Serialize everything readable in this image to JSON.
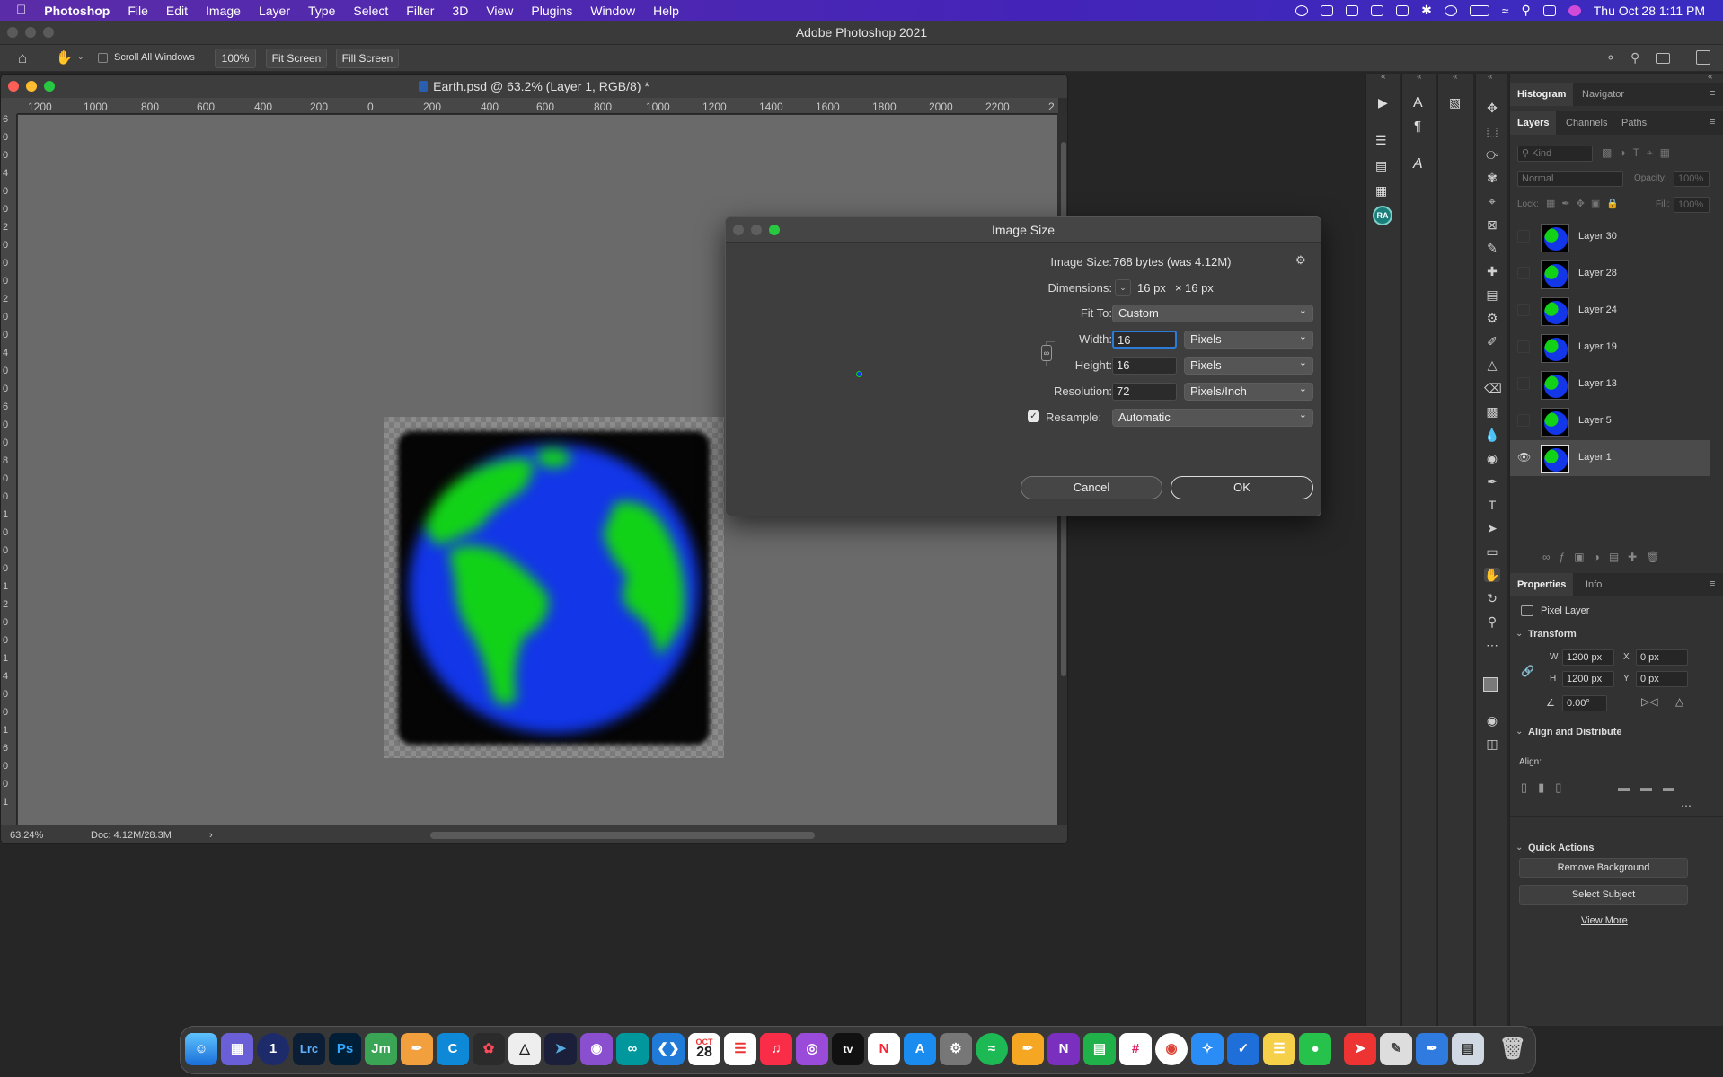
{
  "menubar": {
    "app": "Photoshop",
    "items": [
      "File",
      "Edit",
      "Image",
      "Layer",
      "Type",
      "Select",
      "Filter",
      "3D",
      "View",
      "Plugins",
      "Window",
      "Help"
    ],
    "clock": "Thu Oct 28  1:11 PM"
  },
  "app_title": "Adobe Photoshop 2021",
  "options_bar": {
    "scroll_all_windows": "Scroll All Windows",
    "zoom_100": "100%",
    "fit_screen": "Fit Screen",
    "fill_screen": "Fill Screen"
  },
  "document": {
    "title": "Earth.psd @ 63.2% (Layer 1, RGB/8) *",
    "ruler_ticks": [
      "1200",
      "1000",
      "800",
      "600",
      "400",
      "200",
      "0",
      "200",
      "400",
      "600",
      "800",
      "1000",
      "1200",
      "1400",
      "1600",
      "1800",
      "2000",
      "2200",
      "2"
    ],
    "ruler_v_ticks": [
      "6",
      "0",
      "0",
      "4",
      "0",
      "0",
      "2",
      "0",
      "0",
      "0",
      "2",
      "0",
      "0",
      "4",
      "0",
      "0",
      "6",
      "0",
      "0",
      "8",
      "0",
      "0",
      "1",
      "0",
      "0",
      "0",
      "1",
      "2",
      "0",
      "0",
      "1",
      "4",
      "0",
      "0",
      "1",
      "6",
      "0",
      "0",
      "1"
    ],
    "zoom_status": "63.24%",
    "doc_status": "Doc: 4.12M/28.3M"
  },
  "dialog": {
    "title": "Image Size",
    "image_size_label": "Image Size:",
    "image_size_value": "768 bytes (was 4.12M)",
    "dimensions_label": "Dimensions:",
    "dimensions_w": "16 px",
    "dimensions_x": "×",
    "dimensions_h": "16 px",
    "fit_to_label": "Fit To:",
    "fit_to_value": "Custom",
    "width_label": "Width:",
    "width_value": "16",
    "width_unit": "Pixels",
    "height_label": "Height:",
    "height_value": "16",
    "height_unit": "Pixels",
    "resolution_label": "Resolution:",
    "resolution_value": "72",
    "resolution_unit": "Pixels/Inch",
    "resample_label": "Resample:",
    "resample_value": "Automatic",
    "resample_checked": true,
    "cancel": "Cancel",
    "ok": "OK"
  },
  "panels": {
    "top_tabs": [
      "Histogram",
      "Navigator"
    ],
    "layer_tabs": [
      "Layers",
      "Channels",
      "Paths"
    ],
    "kind_placeholder": "Kind",
    "blend_mode": "Normal",
    "opacity_label": "Opacity:",
    "opacity_value": "100%",
    "lock_label": "Lock:",
    "fill_label": "Fill:",
    "fill_value": "100%",
    "layers": [
      "Layer 30",
      "Layer 28",
      "Layer 24",
      "Layer 19",
      "Layer 13",
      "Layer 5",
      "Layer 1"
    ],
    "selected_layer": "Layer 1",
    "properties_tabs": [
      "Properties",
      "Info"
    ],
    "pixel_layer": "Pixel Layer",
    "transform_title": "Transform",
    "w_label": "W",
    "w_value": "1200 px",
    "x_label": "X",
    "x_value": "0 px",
    "h_label": "H",
    "h_value": "1200 px",
    "y_label": "Y",
    "y_value": "0 px",
    "angle_value": "0.00°",
    "align_title": "Align and Distribute",
    "align_label": "Align:",
    "quick_actions_title": "Quick Actions",
    "remove_background": "Remove Background",
    "select_subject": "Select Subject",
    "view_more": "View More"
  },
  "left_strip": {
    "ra_badge": "RA"
  },
  "dock": {
    "labels": [
      "Lrc",
      "Ps",
      "Jm",
      "tv"
    ],
    "calendar_month": "OCT",
    "calendar_day": "28"
  },
  "colors": {
    "accent": "#2d7bd8",
    "globe_ocean": "#1236e8",
    "globe_land": "#12d218",
    "menubar": "#4424b8"
  }
}
